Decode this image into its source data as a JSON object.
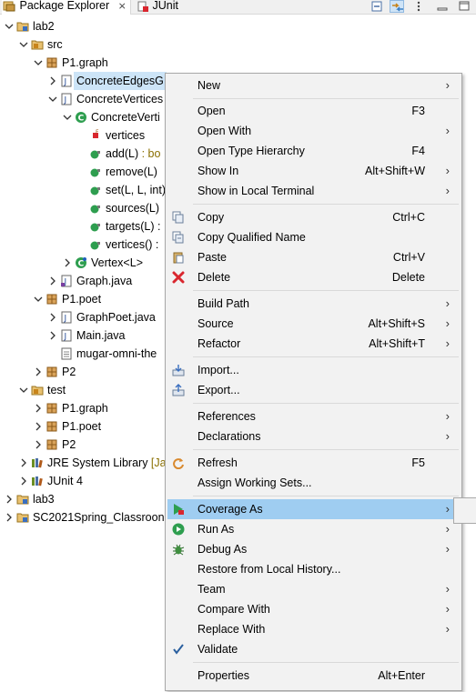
{
  "tabs": {
    "package_explorer": "Package Explorer",
    "junit": "JUnit"
  },
  "tree": {
    "lab2": "lab2",
    "src": "src",
    "p1_graph": "P1.graph",
    "concrete_edges": "ConcreteEdgesG",
    "concrete_vertices": "ConcreteVertices",
    "concrete_verti_class": "ConcreteVerti",
    "vertices_field": "vertices",
    "add_method": "add(L)",
    "add_suffix": " : bo",
    "remove_method": "remove(L)",
    "set_method": "set(L, L, int)",
    "sources_method": "sources(L)",
    "targets_method": "targets(L)",
    "targets_suffix": " :",
    "vertices_method": "vertices()",
    "vertices_suffix": " :",
    "vertex_class": "Vertex<L>",
    "graph_java": "Graph.java",
    "p1_poet": "P1.poet",
    "graphpoet_java": "GraphPoet.java",
    "main_java": "Main.java",
    "mugar_file": "mugar-omni-the",
    "p2": "P2",
    "test": "test",
    "test_p1_graph": "P1.graph",
    "test_p1_poet": "P1.poet",
    "test_p2": "P2",
    "jre": "JRE System Library",
    "jre_suffix": " [Ja",
    "junit4": "JUnit 4",
    "lab3": "lab3",
    "sc2021": "SC2021Spring_Classroon"
  },
  "menu": [
    {
      "label": "New",
      "shortcut": "",
      "arrow": true
    },
    {
      "label": "Open",
      "shortcut": "F3",
      "arrow": false
    },
    {
      "label": "Open With",
      "shortcut": "",
      "arrow": true
    },
    {
      "label": "Open Type Hierarchy",
      "shortcut": "F4",
      "arrow": false
    },
    {
      "label": "Show In",
      "shortcut": "Alt+Shift+W",
      "arrow": true
    },
    {
      "label": "Show in Local Terminal",
      "shortcut": "",
      "arrow": true
    },
    {
      "label": "Copy",
      "shortcut": "Ctrl+C",
      "arrow": false
    },
    {
      "label": "Copy Qualified Name",
      "shortcut": "",
      "arrow": false
    },
    {
      "label": "Paste",
      "shortcut": "Ctrl+V",
      "arrow": false
    },
    {
      "label": "Delete",
      "shortcut": "Delete",
      "arrow": false
    },
    {
      "label": "Build Path",
      "shortcut": "",
      "arrow": true
    },
    {
      "label": "Source",
      "shortcut": "Alt+Shift+S",
      "arrow": true
    },
    {
      "label": "Refactor",
      "shortcut": "Alt+Shift+T",
      "arrow": true
    },
    {
      "label": "Import...",
      "shortcut": "",
      "arrow": false
    },
    {
      "label": "Export...",
      "shortcut": "",
      "arrow": false
    },
    {
      "label": "References",
      "shortcut": "",
      "arrow": true
    },
    {
      "label": "Declarations",
      "shortcut": "",
      "arrow": true
    },
    {
      "label": "Refresh",
      "shortcut": "F5",
      "arrow": false
    },
    {
      "label": "Assign Working Sets...",
      "shortcut": "",
      "arrow": false
    },
    {
      "label": "Coverage As",
      "shortcut": "",
      "arrow": true
    },
    {
      "label": "Run As",
      "shortcut": "",
      "arrow": true
    },
    {
      "label": "Debug As",
      "shortcut": "",
      "arrow": true
    },
    {
      "label": "Restore from Local History...",
      "shortcut": "",
      "arrow": false
    },
    {
      "label": "Team",
      "shortcut": "",
      "arrow": true
    },
    {
      "label": "Compare With",
      "shortcut": "",
      "arrow": true
    },
    {
      "label": "Replace With",
      "shortcut": "",
      "arrow": true
    },
    {
      "label": "Validate",
      "shortcut": "",
      "arrow": false
    },
    {
      "label": "Properties",
      "shortcut": "Alt+Enter",
      "arrow": false
    }
  ],
  "colors": {
    "menu_highlight": "#9fcdf1",
    "selection": "#cce4f7",
    "package_brown": "#a0522d",
    "class_green": "#2e9e4f"
  }
}
